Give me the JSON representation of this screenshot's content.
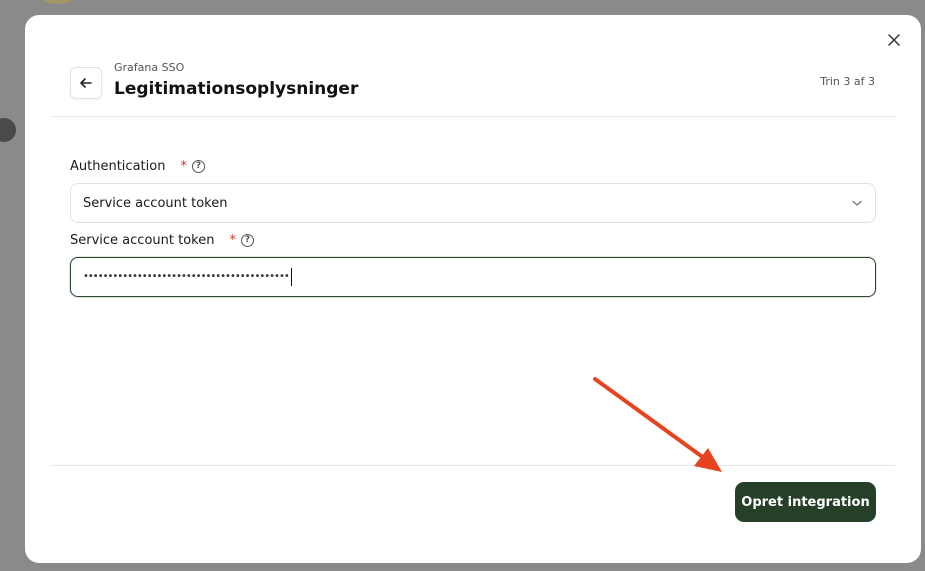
{
  "header": {
    "subtitle": "Grafana SSO",
    "title": "Legitimationsoplysninger",
    "step": "Trin 3 af 3"
  },
  "form": {
    "authentication": {
      "label": "Authentication",
      "required_marker": "*",
      "help_glyph": "?",
      "selected": "Service account token"
    },
    "token": {
      "label": "Service account token",
      "required_marker": "*",
      "help_glyph": "?",
      "masked_value": "••••••••••••••••••••••••••••••••••••••••••"
    }
  },
  "footer": {
    "create_label": "Opret integration"
  },
  "colors": {
    "primary_button": "#253f29",
    "required": "#d0342c",
    "annotation_arrow": "#e8431f"
  }
}
